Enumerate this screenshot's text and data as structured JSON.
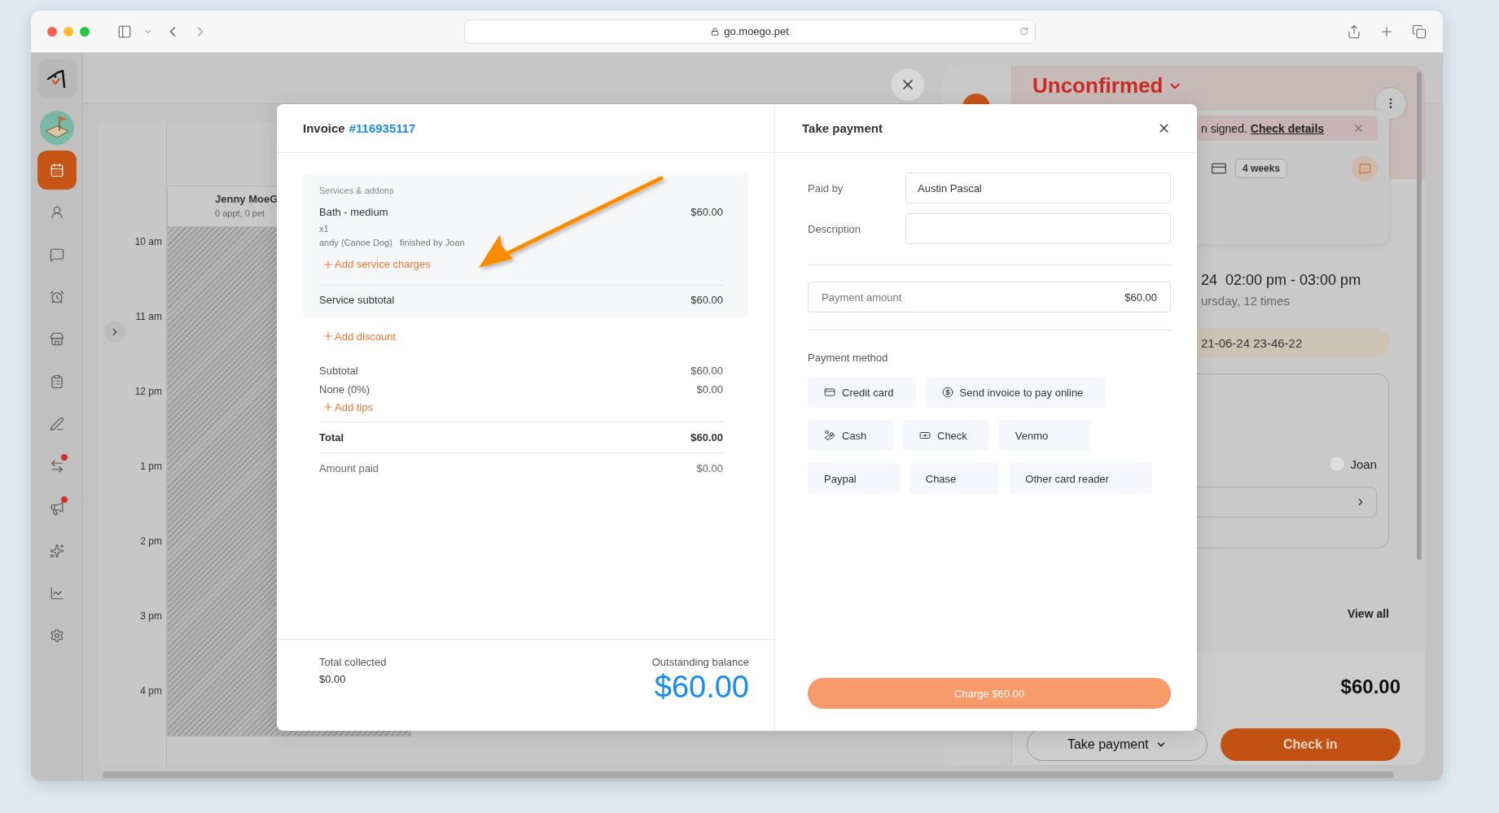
{
  "browser": {
    "url": "go.moego.pet"
  },
  "sidebar": {
    "items": [
      {
        "kind": "logo",
        "selected": false,
        "badge": false
      },
      {
        "kind": "avatar",
        "selected": false,
        "badge": false
      },
      {
        "kind": "calendar",
        "selected": true,
        "badge": false
      },
      {
        "kind": "clients",
        "selected": false,
        "badge": false
      },
      {
        "kind": "messages",
        "selected": false,
        "badge": false
      },
      {
        "kind": "reminders",
        "selected": false,
        "badge": false
      },
      {
        "kind": "store",
        "selected": false,
        "badge": false
      },
      {
        "kind": "tasks",
        "selected": false,
        "badge": false
      },
      {
        "kind": "notes",
        "selected": false,
        "badge": false
      },
      {
        "kind": "transfers",
        "selected": false,
        "badge": true
      },
      {
        "kind": "marketing",
        "selected": false,
        "badge": true
      },
      {
        "kind": "reviews",
        "selected": false,
        "badge": false
      },
      {
        "kind": "reports",
        "selected": false,
        "badge": false
      },
      {
        "kind": "settings",
        "selected": false,
        "badge": false
      }
    ]
  },
  "calendar": {
    "staff": {
      "name": "Jenny MoeG",
      "summary": "0 appt, 0 pet"
    },
    "times": [
      "10 am",
      "11 am",
      "12 pm",
      "1 pm",
      "2 pm",
      "3 pm",
      "4 pm"
    ]
  },
  "appointment": {
    "status": "Unconfirmed",
    "banner": {
      "text": "n signed.",
      "link": "Check details"
    },
    "frequency": "4 weeks",
    "time": "24  02:00 pm - 03:00 pm",
    "repeat": "ursday, 12 times",
    "tag": "21-06-24 23-46-22",
    "staff": "Joan",
    "view_all": "View all",
    "total": "$60.00",
    "buttons": [
      {
        "kind": "menu",
        "label": "Take payment"
      },
      {
        "kind": "primary",
        "label": "Check in"
      }
    ]
  },
  "invoice": {
    "title": "Invoice",
    "number": "#116935117",
    "section": "Services & addons",
    "services": [
      {
        "name": "Bath - medium",
        "price": "$60.00",
        "quantity": "x1",
        "pet": "andy (Canoe Dog)",
        "staff": "finished by Joan"
      }
    ],
    "add_service_charges": "Add service charges",
    "service_subtotal": {
      "label": "Service subtotal",
      "value": "$60.00"
    },
    "add_discount": "Add discount",
    "lines": [
      {
        "label": "Subtotal",
        "value": "$60.00"
      },
      {
        "label": "None (0%)",
        "value": "$0.00"
      }
    ],
    "add_tips": "Add tips",
    "total": {
      "label": "Total",
      "value": "$60.00"
    },
    "amount_paid": {
      "label": "Amount paid",
      "value": "$0.00"
    },
    "total_collected": {
      "label": "Total collected",
      "value": "$0.00"
    },
    "outstanding": {
      "label": "Outstanding balance",
      "value": "$60.00"
    }
  },
  "payment": {
    "title": "Take payment",
    "fields": [
      {
        "label": "Paid by",
        "value": "Austin Pascal"
      },
      {
        "label": "Description"
      }
    ],
    "amount": {
      "label": "Payment amount",
      "value": "$60.00"
    },
    "method_label": "Payment method",
    "methods": [
      {
        "kind": "card",
        "label": "Credit card",
        "selected": false
      },
      {
        "kind": "online",
        "label": "Send invoice to pay online",
        "selected": false
      },
      {
        "kind": "cash",
        "label": "Cash",
        "selected": false
      },
      {
        "kind": "check",
        "label": "Check",
        "selected": false
      },
      {
        "kind": "plain",
        "label": "Venmo",
        "selected": false
      },
      {
        "kind": "plain",
        "label": "Paypal",
        "selected": false
      },
      {
        "kind": "plain",
        "label": "Chase",
        "selected": false
      },
      {
        "kind": "plain",
        "label": "Other card reader",
        "selected": false
      }
    ],
    "charge": "Charge $60.00"
  }
}
